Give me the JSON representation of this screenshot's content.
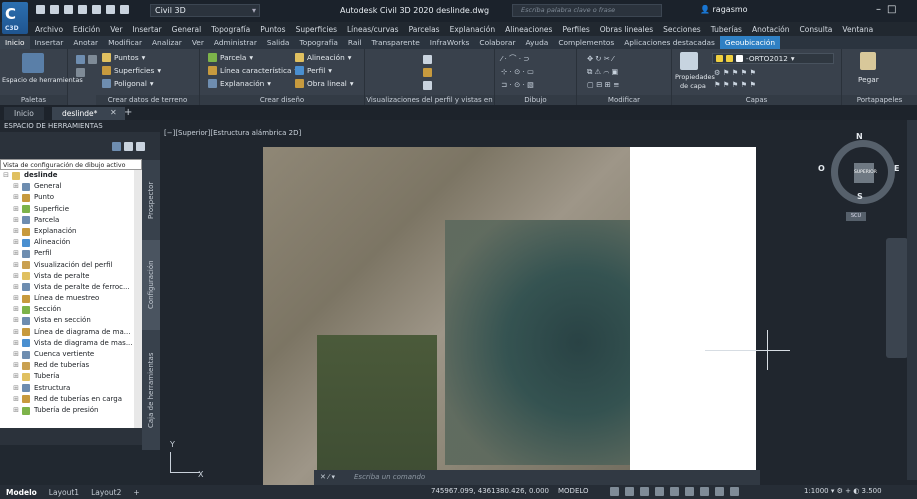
{
  "app": {
    "title": "Autodesk Civil 3D 2020   deslinde.dwg",
    "logo_letter": "C",
    "logo_sub": "C3D"
  },
  "titlebar": {
    "workspace": "Civil 3D",
    "search_placeholder": "Escriba palabra clave o frase",
    "user": "ragasmo"
  },
  "menubar": [
    "Archivo",
    "Edición",
    "Ver",
    "Insertar",
    "General",
    "Topografía",
    "Puntos",
    "Superficies",
    "Líneas/curvas",
    "Parcelas",
    "Explanación",
    "Alineaciones",
    "Perfiles",
    "Obras lineales",
    "Secciones",
    "Tuberías",
    "Anotación",
    "Consulta",
    "Ventana"
  ],
  "ribbon_tabs": [
    "Inicio",
    "Insertar",
    "Anotar",
    "Modificar",
    "Analizar",
    "Ver",
    "Administrar",
    "Salida",
    "Topografía",
    "Rail",
    "Transparente",
    "InfraWorks",
    "Colaborar",
    "Ayuda",
    "Complementos",
    "Aplicaciones destacadas",
    "Geoubicación"
  ],
  "ribbon": {
    "tool_space": "Espacio de herramientas",
    "puntos": "Puntos",
    "superficies": "Superficies",
    "poligonal": "Poligonal",
    "parcela": "Parcela",
    "linea_caracteristica": "Línea característica",
    "explanacion": "Explanación",
    "alineacion": "Alineación",
    "perfil": "Perfil",
    "obra_lineal": "Obra lineal",
    "layer_name": "-ORTO2012",
    "propiedades": "Propiedades",
    "de_capa": "de capa",
    "pegar": "Pegar",
    "panels": {
      "paletas": "Paletas",
      "crear_datos": "Crear datos de terreno",
      "crear_diseno": "Crear diseño",
      "visualizaciones": "Visualizaciones del perfil y vistas en sección",
      "dibujo": "Dibujo",
      "modificar": "Modificar",
      "capas": "Capas",
      "portapapeles": "Portapapeles"
    }
  },
  "doc_tabs": [
    "Inicio",
    "deslinde*"
  ],
  "palette": {
    "title": "ESPACIO DE HERRAMIENTAS",
    "view_dropdown": "Vista de configuración de dibujo activo",
    "tree": [
      "deslinde",
      "General",
      "Punto",
      "Superficie",
      "Parcela",
      "Explanación",
      "Alineación",
      "Perfil",
      "Visualización del perfil",
      "Vista de peralte",
      "Vista de peralte de ferroc...",
      "Línea de muestreo",
      "Sección",
      "Vista en sección",
      "Línea de diagrama de ma...",
      "Vista de diagrama de mas...",
      "Cuenca vertiente",
      "Red de tuberías",
      "Tubería",
      "Estructura",
      "Red de tuberías en carga",
      "Tubería de presión"
    ],
    "side_tabs": [
      "Prospector",
      "Configuración",
      "Caja de herramientas"
    ]
  },
  "viewport": {
    "label": "[−][Superior][Estructura alámbrica 2D]",
    "ucs_y": "Y",
    "ucs_x": "X",
    "navcube": {
      "face": "SUPERIOR",
      "n": "N",
      "s": "S",
      "e": "E",
      "o": "O",
      "wcs": "SCU"
    }
  },
  "command": {
    "placeholder": "Escriba un comando"
  },
  "status": {
    "layouts": [
      "Modelo",
      "Layout1",
      "Layout2"
    ],
    "coords": "745967.099, 4361380.426, 0.000",
    "mode": "MODELO",
    "scale": "1:1000",
    "lineweight": "3.500"
  },
  "colors": {
    "accent": "#2f80c4",
    "background": "#212830"
  }
}
